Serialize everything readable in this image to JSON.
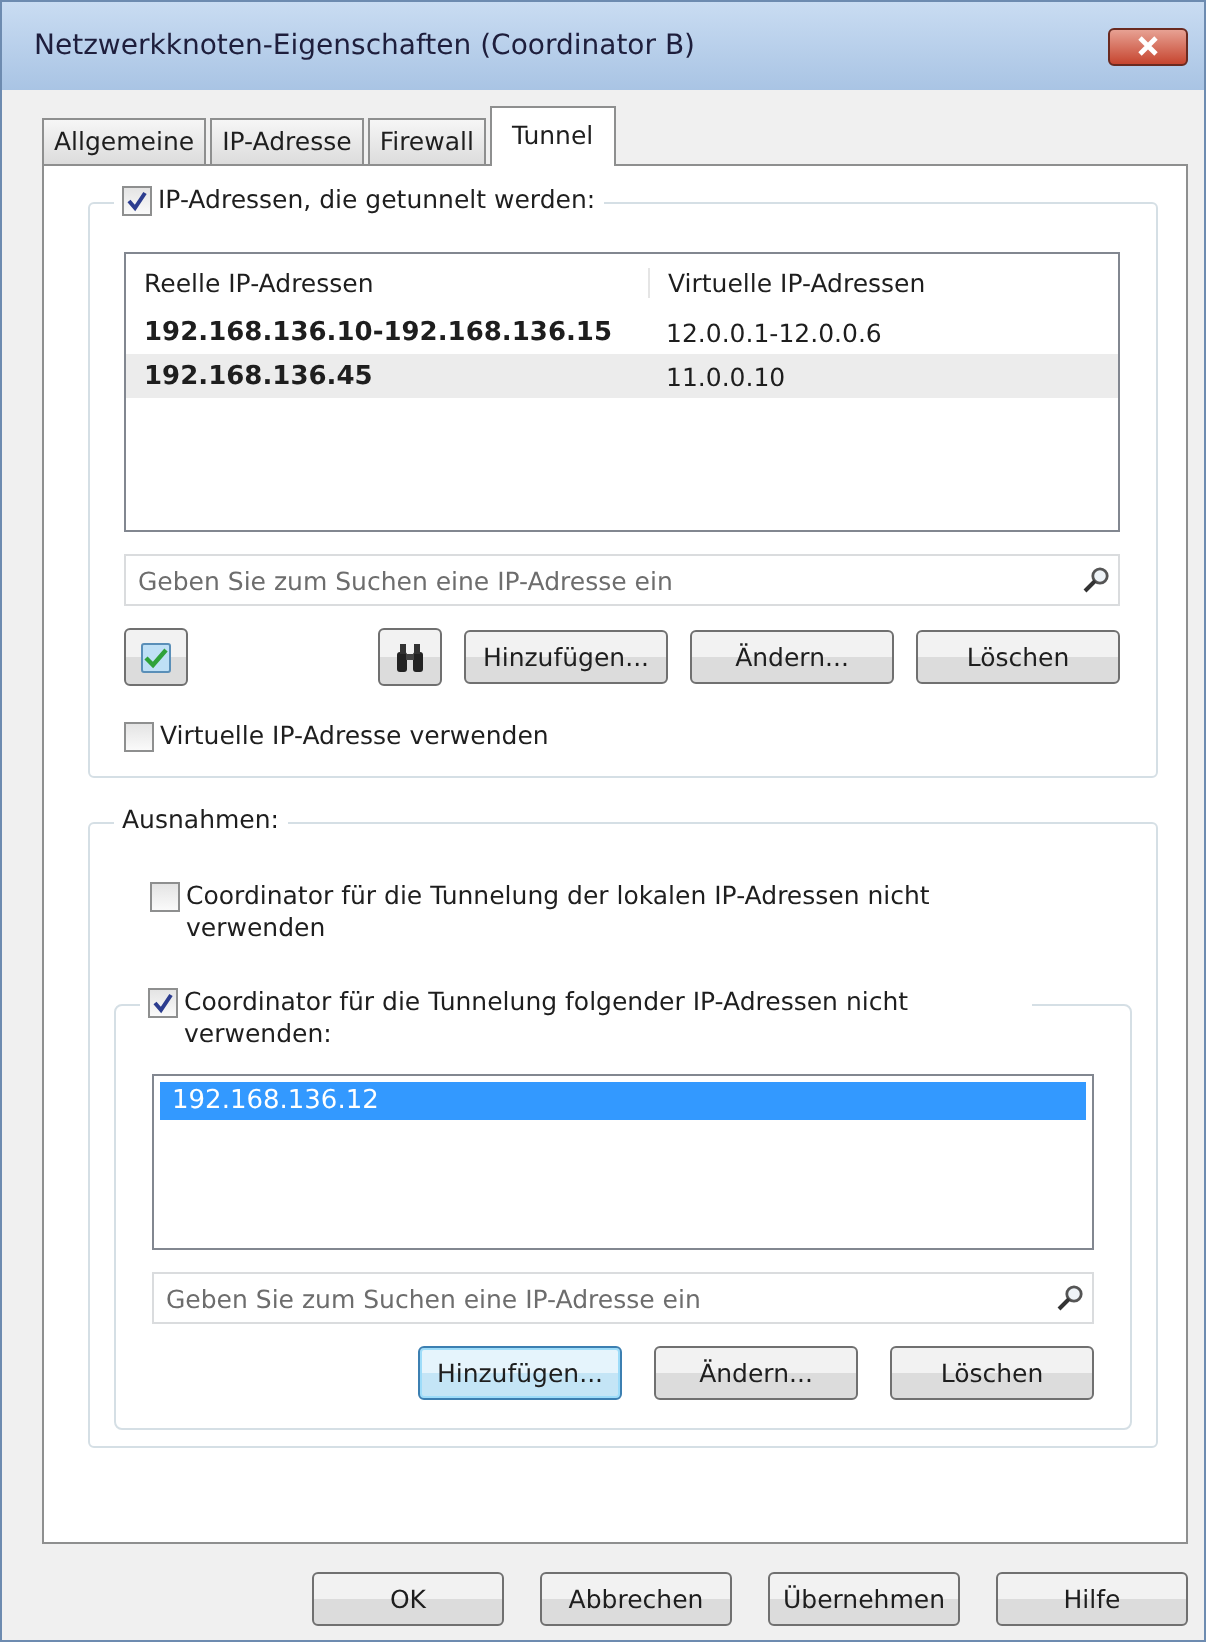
{
  "window": {
    "title": "Netzwerkknoten-Eigenschaften (Coordinator B)"
  },
  "tabs": [
    {
      "label": "Allgemeine",
      "selected": false
    },
    {
      "label": "IP-Adresse",
      "selected": false
    },
    {
      "label": "Firewall",
      "selected": false
    },
    {
      "label": "Tunnel",
      "selected": true
    }
  ],
  "tunnel_group": {
    "label": "IP-Adressen, die getunnelt werden:",
    "checked": true,
    "table": {
      "columns": [
        "Reelle IP-Adressen",
        "Virtuelle IP-Adressen"
      ],
      "rows": [
        [
          "192.168.136.10-192.168.136.15",
          "12.0.0.1-12.0.0.6"
        ],
        [
          "192.168.136.45",
          "11.0.0.10"
        ]
      ]
    },
    "search": {
      "placeholder": "Geben Sie zum Suchen eine IP-Adresse ein"
    },
    "buttons": [
      {
        "label": "Hinzufügen...",
        "focused": false
      },
      {
        "label": "Ändern...",
        "focused": false
      },
      {
        "label": "Löschen",
        "focused": false
      }
    ],
    "virtual_checkbox": {
      "label": "Virtuelle IP-Adresse verwenden",
      "checked": false
    }
  },
  "exceptions": {
    "title": "Ausnahmen:",
    "local_checkbox": {
      "label": "Coordinator für die Tunnelung der lokalen IP-Adressen nicht verwenden",
      "checked": false
    },
    "list_group": {
      "label": "Coordinator für die Tunnelung folgender IP-Adressen nicht verwenden:",
      "checked": true,
      "items": [
        {
          "text": "192.168.136.12",
          "selected": true
        }
      ],
      "search": {
        "placeholder": "Geben Sie zum Suchen eine IP-Adresse ein"
      },
      "buttons": [
        {
          "label": "Hinzufügen...",
          "focused": true
        },
        {
          "label": "Ändern...",
          "focused": false
        },
        {
          "label": "Löschen",
          "focused": false
        }
      ]
    }
  },
  "footer_buttons": [
    "OK",
    "Abbrechen",
    "Übernehmen",
    "Hilfe"
  ]
}
